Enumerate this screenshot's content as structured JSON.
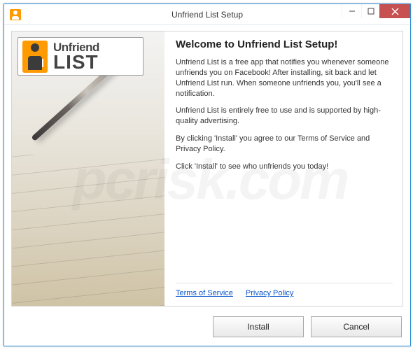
{
  "window": {
    "title": "Unfriend List Setup"
  },
  "logo": {
    "line1": "Unfriend",
    "line2": "LIST"
  },
  "main": {
    "heading": "Welcome to Unfriend List Setup!",
    "para1": "Unfriend List is a free app that notifies you whenever someone unfriends you on Facebook! After installing, sit back and let Unfriend List run. When someone unfriends you, you'll see a notification.",
    "para2": "Unfriend List is entirely free to use and is supported by high-quality advertising.",
    "para3": "By clicking 'Install' you agree to our Terms of Service and Privacy Policy.",
    "para4": "Click 'Install' to see who unfriends you today!"
  },
  "links": {
    "tos": "Terms of Service",
    "privacy": "Privacy Policy"
  },
  "buttons": {
    "install": "Install",
    "cancel": "Cancel"
  },
  "watermark": "pcrisk.com"
}
